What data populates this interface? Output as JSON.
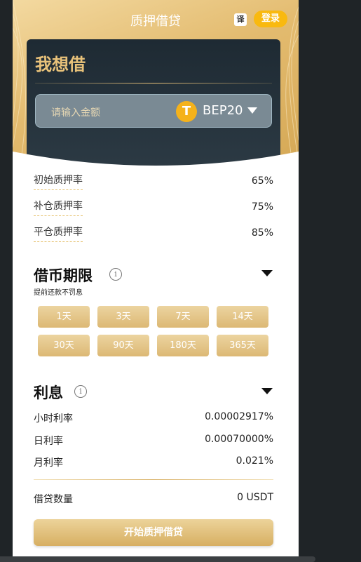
{
  "header": {
    "title": "质押借贷",
    "translate_icon": "translate-icon",
    "translate_glyph": "译",
    "login_label": "登录"
  },
  "borrow": {
    "title": "我想借",
    "amount_placeholder": "请输入金额",
    "coin_icon": "tether-icon",
    "coin_glyph": "T",
    "coin_name": "BEP20"
  },
  "rates": [
    {
      "label": "初始质押率",
      "value": "65%"
    },
    {
      "label": "补仓质押率",
      "value": "75%"
    },
    {
      "label": "平仓质押率",
      "value": "85%"
    }
  ],
  "term": {
    "title": "借币期限",
    "note": "提前还款不罚息",
    "info_glyph": "i",
    "options": [
      "1天",
      "3天",
      "7天",
      "14天",
      "30天",
      "90天",
      "180天",
      "365天"
    ]
  },
  "interest": {
    "title": "利息",
    "info_glyph": "i",
    "rows": [
      {
        "label": "小时利率",
        "value": "0.00002917%"
      },
      {
        "label": "日利率",
        "value": "0.00070000%"
      },
      {
        "label": "月利率",
        "value": "0.021%"
      }
    ]
  },
  "loan": {
    "label": "借贷数量",
    "value": "0 USDT"
  },
  "submit_label": "开始质押借贷",
  "colors": {
    "gold": "#e3bb6f",
    "dark_card": "#1e2a33",
    "login_yellow": "#f9b90f",
    "coin_yellow": "#f5b21b"
  }
}
